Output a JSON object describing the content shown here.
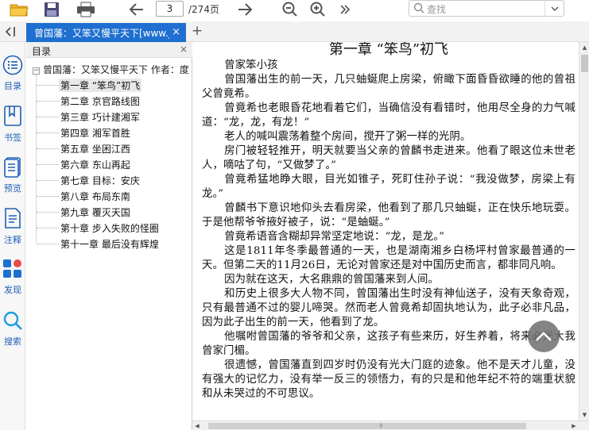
{
  "toolbar": {
    "page_current": "3",
    "page_total": "/274页",
    "search_placeholder": "查找"
  },
  "tab": {
    "title": "曾国藩：又笨又慢平天下[www.j",
    "close": "×",
    "add": "+"
  },
  "rail": {
    "items": [
      {
        "label": "目录",
        "icon": "list-icon"
      },
      {
        "label": "书签",
        "icon": "bookmark-icon"
      },
      {
        "label": "预览",
        "icon": "preview-icon"
      },
      {
        "label": "注释",
        "icon": "annotation-icon"
      },
      {
        "label": "发现",
        "icon": "discover-icon"
      },
      {
        "label": "搜索",
        "icon": "search-icon"
      }
    ]
  },
  "toc": {
    "header": "目录",
    "close": "×",
    "root": "曾国藩：又笨又慢平天下 作者：度",
    "toggle": "−",
    "items": [
      "第一章 “笨鸟”初飞",
      "第二章 京官路线图",
      "第三章 巧计建湘军",
      "第四章 湘军首胜",
      "第五章 坐困江西",
      "第六章 东山再起",
      "第七章 目标：安庆",
      "第八章 布局东南",
      "第九章 覆灭天国",
      "第十章 步入失败的怪圈",
      "第十一章 最后没有辉煌"
    ],
    "active_index": 0
  },
  "document": {
    "chapter_title": "第一章 “笨鸟”初飞",
    "paragraphs": [
      "曾家笨小孩",
      "曾国藩出生的前一天，几只蚰蜒爬上房梁，俯瞰下面昏昏欲睡的他的曾祖父曾竟希。",
      "曾竟希也老眼昏花地看着它们，当确信没有看错时，他用尽全身的力气喊道：“龙，龙，有龙！”",
      "老人的喊叫震荡着整个房间，搅开了粥一样的光阴。",
      "房门被轻轻推开，明天就要当父亲的曾麟书走进来。他看了眼这位未世老人，嘀咕了句，“又做梦了。”",
      "曾竟希猛地睁大眼，目光如锥子，死盯住孙子说：“我没做梦，房梁上有龙。”",
      "曾麟书下意识地仰头去看房梁，他看到了那几只蚰蜒，正在快乐地玩耍。于是他帮爷爷掖好被子，说：“是蚰蜒。”",
      "曾竟希语音含糊却异常坚定地说：“龙，是龙。”",
      "这是1811年冬季最普通的一天，也是湖南湘乡白杨坪村曾家最普通的一天。但第二天的11月26日，无论对曾家还是对中国历史而言，都非同凡响。",
      "因为就在这天，大名鼎鼎的曾国藩来到人间。",
      "和历史上很多大人物不同，曾国藩出生时没有神仙送子，没有天象奇观，只有最普通不过的婴儿啼哭。然而老人曾竟希却固执地认为，此子必非凡品，因为此子出生的前一天，他看到了龙。",
      "他嘱咐曾国藩的爷爷和父亲，这孩子有些来历，好生养着，将来必光大我曾家门楣。",
      "很遗憾，曾国藩直到四岁时仍没有光大门庭的迹象。他不是天才儿童，没有强大的记忆力，没有举一反三的领悟力，有的只是和他年纪不符的端重状貌和从未哭过的不可思议。"
    ]
  },
  "colors": {
    "tab_bg": "#1e6fcf",
    "rail_label": "#1e5fb4",
    "icon_blue": "#1e5fb4",
    "folder_yellow": "#f0b429",
    "discover_red": "#e94b4b"
  }
}
